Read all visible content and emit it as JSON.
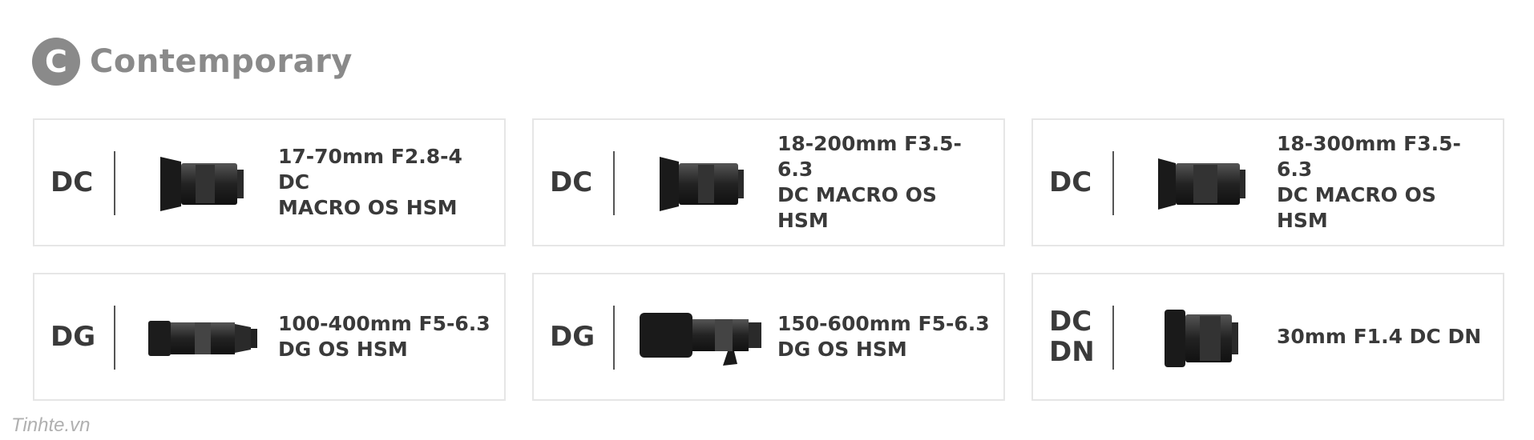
{
  "header": {
    "badge_letter": "C",
    "title": "Contemporary"
  },
  "lenses": [
    {
      "mount": "DC",
      "name": "17-70mm F2.8-4 DC\nMACRO OS HSM",
      "icon": "zoom-lens-hood-icon"
    },
    {
      "mount": "DC",
      "name": "18-200mm F3.5-6.3\nDC MACRO OS HSM",
      "icon": "zoom-lens-hood-icon"
    },
    {
      "mount": "DC",
      "name": "18-300mm F3.5-6.3\nDC MACRO OS HSM",
      "icon": "zoom-lens-hood-icon"
    },
    {
      "mount": "DG",
      "name": "100-400mm F5-6.3\nDG OS HSM",
      "icon": "telephoto-lens-icon"
    },
    {
      "mount": "DG",
      "name": "150-600mm F5-6.3\nDG OS HSM",
      "icon": "telephoto-lens-hood-icon"
    },
    {
      "mount": "DC\nDN",
      "name": "30mm F1.4 DC DN",
      "icon": "prime-lens-icon"
    }
  ],
  "watermark": "Tinhte.vn"
}
